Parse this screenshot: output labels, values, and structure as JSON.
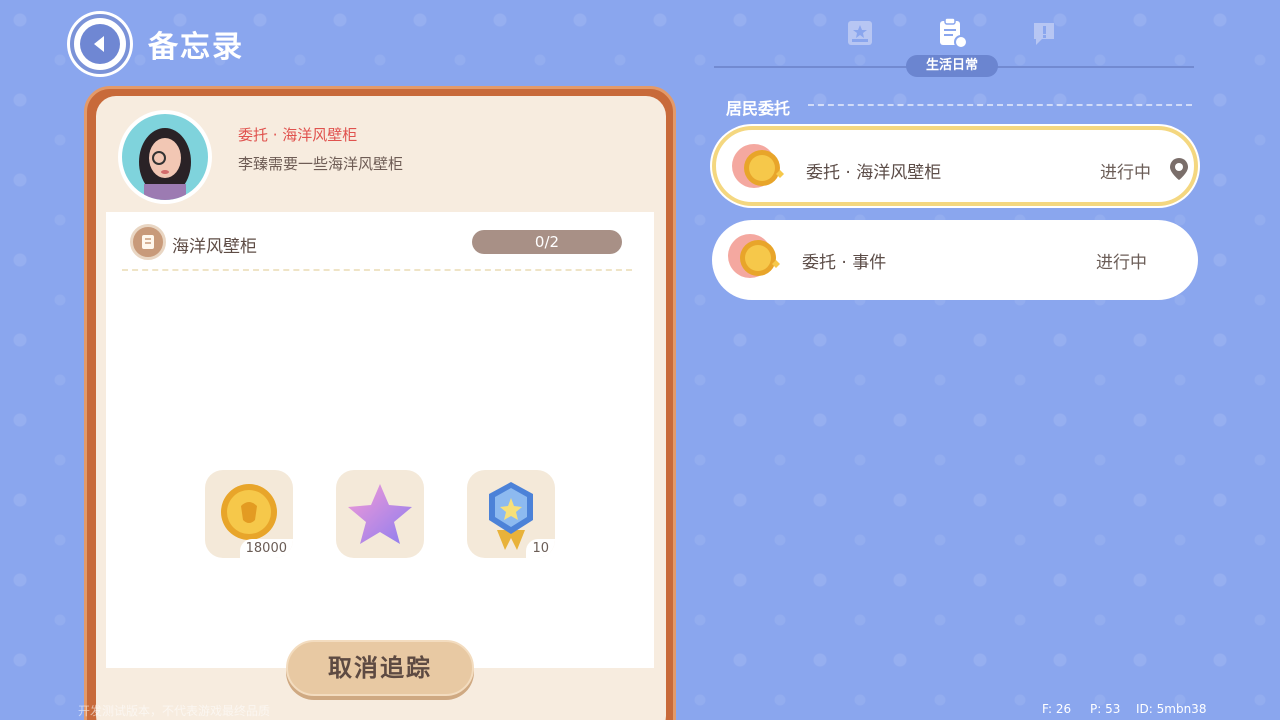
{
  "header": {
    "title": "备忘录"
  },
  "card": {
    "quest_title": "委托 · 海洋风壁柜",
    "quest_desc": "李臻需要一些海洋风壁柜",
    "requirement": {
      "label": "海洋风壁柜",
      "progress": "0/2"
    },
    "rewards": [
      {
        "icon": "gold-coin-icon",
        "qty": "18000"
      },
      {
        "icon": "star-icon",
        "qty": ""
      },
      {
        "icon": "medal-icon",
        "qty": "10"
      }
    ],
    "cancel_button": "取消追踪"
  },
  "tabs": {
    "active_label": "生活日常"
  },
  "section": {
    "title": "居民委托"
  },
  "quests": [
    {
      "name": "委托 · 海洋风壁柜",
      "status": "进行中"
    },
    {
      "name": "委托 · 事件",
      "status": "进行中"
    }
  ],
  "footer": {
    "disclaimer": "开发测试版本，不代表游戏最终品质",
    "fps": "F: 26",
    "ping": "P: 53",
    "id": "ID: 5mbn38"
  },
  "colors": {
    "background": "#8aa6ee",
    "accent_red": "#e0524e",
    "card_frame": "#c86a3a",
    "selected_border": "#f4d780"
  }
}
